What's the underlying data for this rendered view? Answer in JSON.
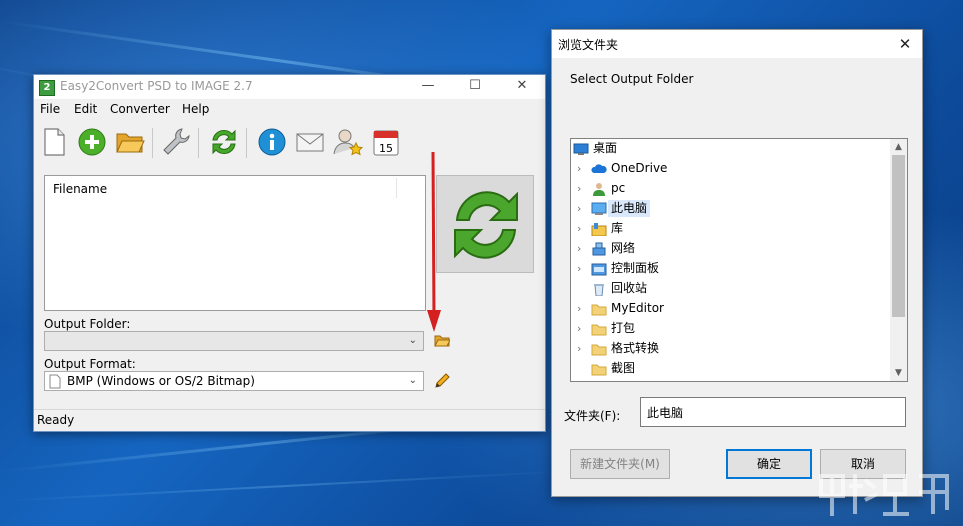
{
  "app": {
    "title": "Easy2Convert PSD to IMAGE 2.7",
    "icon_letter": "2",
    "menu": [
      "File",
      "Edit",
      "Converter",
      "Help"
    ],
    "toolbar": [
      "new-file-icon",
      "add-icon",
      "open-folder-icon",
      "settings-wrench-icon",
      "convert-icon",
      "info-icon",
      "mail-icon",
      "user-star-icon",
      "calendar-icon"
    ],
    "calendar_day": "15",
    "file_list": {
      "columns": [
        "Filename"
      ]
    },
    "output_folder": {
      "label": "Output Folder:",
      "value": ""
    },
    "output_format": {
      "label": "Output Format:",
      "value": "BMP (Windows or OS/2 Bitmap)"
    },
    "status": "Ready"
  },
  "dialog": {
    "title": "浏览文件夹",
    "prompt": "Select Output Folder",
    "tree": [
      {
        "label": "桌面",
        "icon": "desktop-icon",
        "expander": false,
        "level": 0
      },
      {
        "label": "OneDrive",
        "icon": "cloud-icon",
        "expander": true,
        "level": 1
      },
      {
        "label": "pc",
        "icon": "user-icon",
        "expander": true,
        "level": 1
      },
      {
        "label": "此电脑",
        "icon": "computer-icon",
        "expander": true,
        "level": 1,
        "selected": true
      },
      {
        "label": "库",
        "icon": "library-icon",
        "expander": true,
        "level": 1
      },
      {
        "label": "网络",
        "icon": "network-icon",
        "expander": true,
        "level": 1
      },
      {
        "label": "控制面板",
        "icon": "control-panel-icon",
        "expander": true,
        "level": 1
      },
      {
        "label": "回收站",
        "icon": "recycle-bin-icon",
        "expander": false,
        "level": 1
      },
      {
        "label": "MyEditor",
        "icon": "folder-icon",
        "expander": true,
        "level": 1
      },
      {
        "label": "打包",
        "icon": "folder-icon",
        "expander": true,
        "level": 1
      },
      {
        "label": "格式转换",
        "icon": "folder-icon",
        "expander": true,
        "level": 1
      },
      {
        "label": "截图",
        "icon": "folder-icon",
        "expander": false,
        "level": 1
      }
    ],
    "folder_label": "文件夹(F):",
    "folder_value": "此电脑",
    "new_folder_button": "新建文件夹(M)",
    "ok_button": "确定",
    "cancel_button": "取消"
  },
  "colors": {
    "accent": "#0078d7",
    "arrow": "#d42020",
    "desktop": "#1565c0"
  }
}
